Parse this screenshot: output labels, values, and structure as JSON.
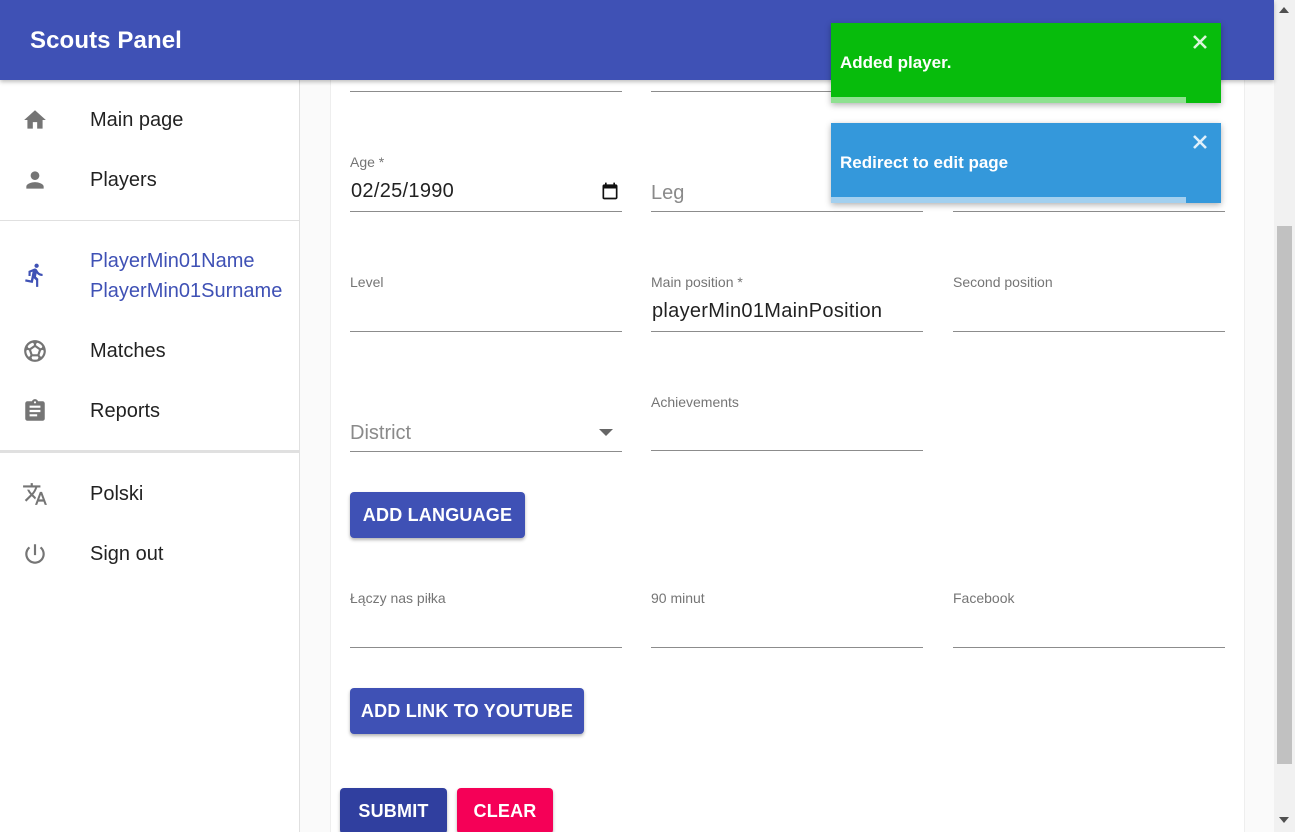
{
  "app": {
    "title": "Scouts Panel"
  },
  "sidebar": {
    "main_page": "Main page",
    "players": "Players",
    "player_name": "PlayerMin01Name",
    "player_surname": "PlayerMin01Surname",
    "matches": "Matches",
    "reports": "Reports",
    "language": "Polski",
    "sign_out": "Sign out"
  },
  "form": {
    "age": {
      "label": "Age *",
      "value": "02/25/1990"
    },
    "leg": {
      "placeholder": "Leg"
    },
    "level": {
      "label": "Level",
      "value": ""
    },
    "main_position": {
      "label": "Main position *",
      "value": "playerMin01MainPosition"
    },
    "second_position": {
      "label": "Second position",
      "value": ""
    },
    "district": {
      "placeholder": "District"
    },
    "achievements": {
      "label": "Achievements",
      "value": ""
    },
    "add_language": "Add language",
    "laczy_nas_pilka": {
      "label": "Łączy nas piłka",
      "value": ""
    },
    "minut90": {
      "label": "90 minut",
      "value": ""
    },
    "facebook": {
      "label": "Facebook",
      "value": ""
    },
    "add_youtube": "Add link to Youtube",
    "submit": "Submit",
    "clear": "Clear"
  },
  "toasts": [
    {
      "message": "Added player.",
      "color": "#07bc0c",
      "progress": 0.91
    },
    {
      "message": "Redirect to edit page",
      "color": "#3498db",
      "progress": 0.91
    }
  ],
  "colors": {
    "primary": "#3f51b5",
    "secondary": "#f50057",
    "success": "#07bc0c",
    "info": "#3498db"
  }
}
